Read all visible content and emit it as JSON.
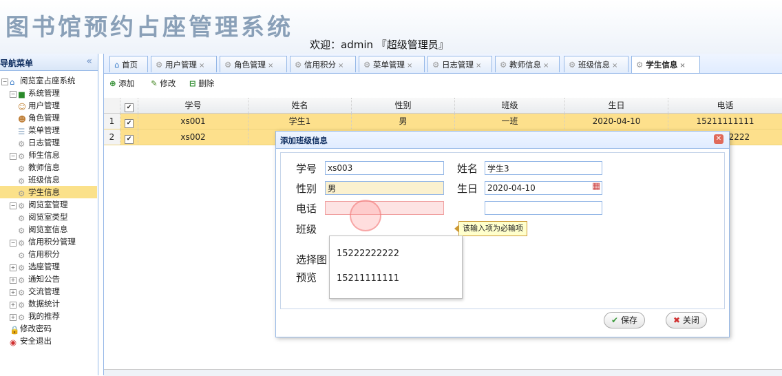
{
  "header": {
    "title": "图书馆预约占座管理系统",
    "welcome": "欢迎：admin 『超级管理员』"
  },
  "sidebar": {
    "title": "导航菜单",
    "collapse_icon": "«",
    "items": [
      {
        "label": "阅览室占座系统",
        "icon": "home-icon"
      },
      {
        "label": "系统管理",
        "icon": "folder-icon"
      },
      {
        "label": "用户管理",
        "icon": "user-icon"
      },
      {
        "label": "角色管理",
        "icon": "users-icon"
      },
      {
        "label": "菜单管理",
        "icon": "menu-icon"
      },
      {
        "label": "日志管理",
        "icon": "gear-icon"
      },
      {
        "label": "师生信息",
        "icon": "gear-icon"
      },
      {
        "label": "教师信息",
        "icon": "gear-icon"
      },
      {
        "label": "班级信息",
        "icon": "gear-icon"
      },
      {
        "label": "学生信息",
        "icon": "gear-icon"
      },
      {
        "label": "阅览室管理",
        "icon": "gear-icon"
      },
      {
        "label": "阅览室类型",
        "icon": "gear-icon"
      },
      {
        "label": "阅览室信息",
        "icon": "gear-icon"
      },
      {
        "label": "信用积分管理",
        "icon": "gear-icon"
      },
      {
        "label": "信用积分",
        "icon": "gear-icon"
      },
      {
        "label": "选座管理",
        "icon": "gear-icon"
      },
      {
        "label": "通知公告",
        "icon": "gear-icon"
      },
      {
        "label": "交流管理",
        "icon": "gear-icon"
      },
      {
        "label": "数据统计",
        "icon": "gear-icon"
      },
      {
        "label": "我的推荐",
        "icon": "gear-icon"
      },
      {
        "label": "修改密码",
        "icon": "lock-icon"
      },
      {
        "label": "安全退出",
        "icon": "exit-icon"
      }
    ]
  },
  "tabs": [
    "首页",
    "用户管理",
    "角色管理",
    "信用积分",
    "菜单管理",
    "日志管理",
    "教师信息",
    "班级信息",
    "学生信息"
  ],
  "toolbar": {
    "add": "添加",
    "edit": "修改",
    "delete": "删除"
  },
  "grid": {
    "columns": [
      "学号",
      "姓名",
      "性别",
      "班级",
      "生日",
      "电话"
    ],
    "rows": [
      {
        "num": "1",
        "id": "xs001",
        "name": "学生1",
        "gender": "男",
        "class": "一班",
        "birthday": "2020-04-10",
        "phone": "15211111111"
      },
      {
        "num": "2",
        "id": "xs002",
        "phone_tail": "22222"
      }
    ]
  },
  "dialog": {
    "title": "添加班级信息",
    "labels": {
      "id": "学号",
      "name": "姓名",
      "gender": "性别",
      "birthday": "生日",
      "phone": "电话",
      "class": "班级",
      "select": "选择图",
      "preview": "预览"
    },
    "values": {
      "id": "xs003",
      "name": "学生3",
      "gender": "男",
      "birthday": "2020-04-10",
      "phone": ""
    },
    "tooltip": "该输入项为必输项",
    "suggestions": [
      "15222222222",
      "15211111111"
    ],
    "save": "保存",
    "close": "关闭"
  }
}
